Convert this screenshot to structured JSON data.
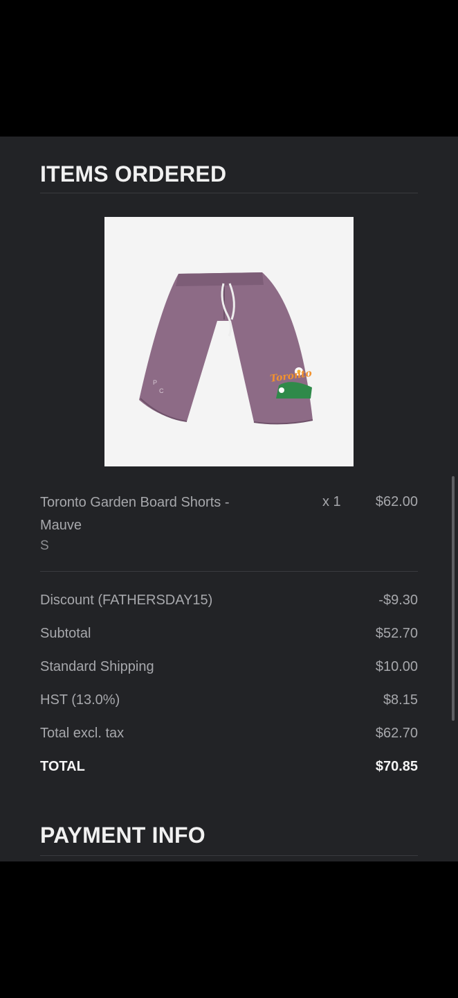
{
  "sections": {
    "items_ordered_title": "ITEMS ORDERED",
    "payment_info_title": "PAYMENT INFO"
  },
  "item": {
    "name": "Toronto Garden Board Shorts - Mauve",
    "variant": "S",
    "quantity": "x 1",
    "price": "$62.00",
    "image_icon": "mauve-board-shorts-image",
    "image_text": "Toronto"
  },
  "summary": {
    "discount_label": "Discount (FATHERSDAY15)",
    "discount_value": "-$9.30",
    "subtotal_label": "Subtotal",
    "subtotal_value": "$52.70",
    "shipping_label": "Standard Shipping",
    "shipping_value": "$10.00",
    "tax_label": "HST (13.0%)",
    "tax_value": "$8.15",
    "total_excl_label": "Total excl. tax",
    "total_excl_value": "$62.70",
    "total_label": "TOTAL",
    "total_value": "$70.85"
  },
  "colors": {
    "panel_background": "#222326",
    "text_primary": "#f1f1f1",
    "text_secondary": "#a7a8ac",
    "shorts_mauve": "#8d6b86"
  }
}
